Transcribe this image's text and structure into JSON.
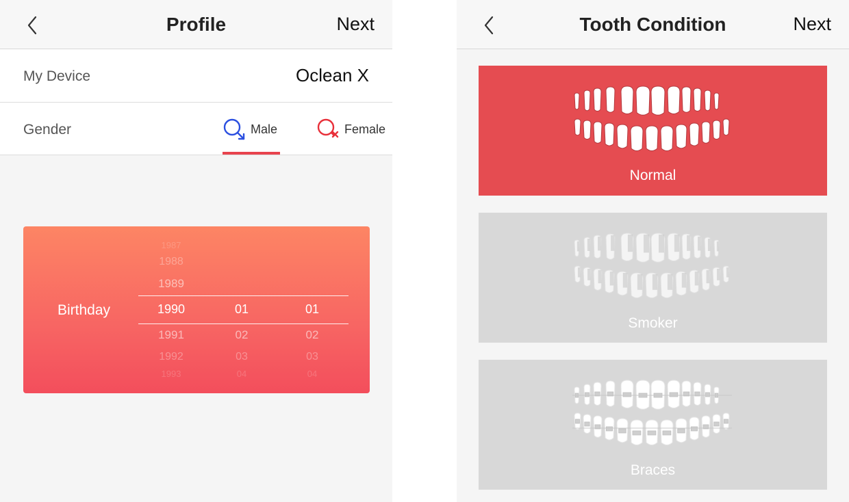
{
  "profile": {
    "title": "Profile",
    "next_label": "Next",
    "device": {
      "label": "My Device",
      "value": "Oclean X"
    },
    "gender": {
      "label": "Gender",
      "options": [
        {
          "label": "Male",
          "icon": "male-icon",
          "color": "#2b4fe0",
          "selected": true
        },
        {
          "label": "Female",
          "icon": "female-icon",
          "color": "#e8303a",
          "selected": false
        }
      ],
      "accent": "#e8434e"
    },
    "birthday": {
      "label": "Birthday",
      "years": [
        "1987",
        "1988",
        "1989",
        "1990",
        "1991",
        "1992",
        "1993"
      ],
      "months": [
        "01",
        "02",
        "03",
        "04"
      ],
      "days": [
        "01",
        "02",
        "03",
        "04"
      ],
      "selected": {
        "year": "1990",
        "month": "01",
        "day": "01"
      }
    }
  },
  "tooth": {
    "title": "Tooth Condition",
    "next_label": "Next",
    "options": [
      {
        "label": "Normal",
        "icon": "normal-teeth-icon",
        "selected": true
      },
      {
        "label": "Smoker",
        "icon": "smoker-teeth-icon",
        "selected": false
      },
      {
        "label": "Braces",
        "icon": "braces-teeth-icon",
        "selected": false
      }
    ],
    "active_color": "#e54c51",
    "inactive_color": "#d8d8d8"
  },
  "icons": {
    "back": "chevron-left-icon"
  }
}
